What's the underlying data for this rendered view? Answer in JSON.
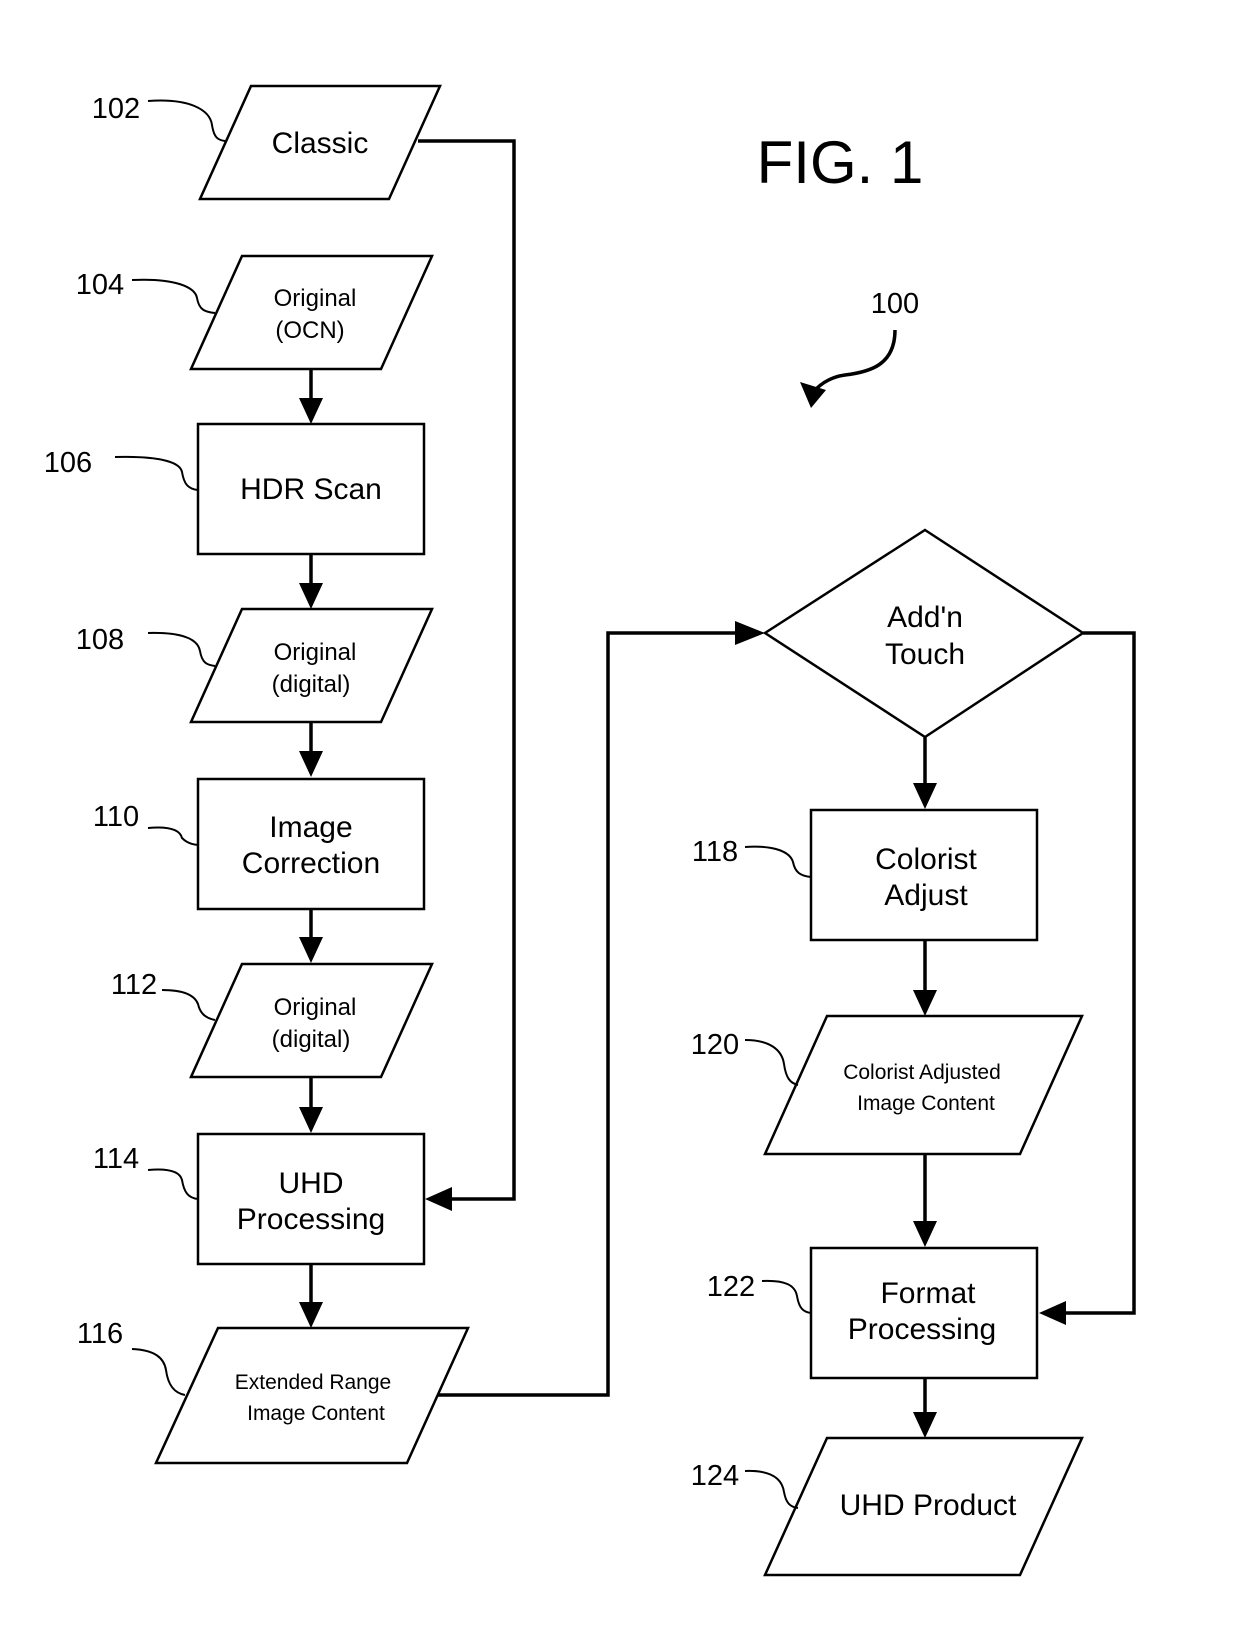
{
  "figure": {
    "title": "FIG. 1",
    "reference": "100"
  },
  "nodes": {
    "n102": {
      "ref": "102",
      "shape": "parallelogram",
      "lines": [
        "Classic"
      ]
    },
    "n104": {
      "ref": "104",
      "shape": "parallelogram",
      "lines": [
        "Original",
        "(OCN)"
      ]
    },
    "n106": {
      "ref": "106",
      "shape": "rectangle",
      "lines": [
        "HDR Scan"
      ]
    },
    "n108": {
      "ref": "108",
      "shape": "parallelogram",
      "lines": [
        "Original",
        "(digital)"
      ]
    },
    "n110": {
      "ref": "110",
      "shape": "rectangle",
      "lines": [
        "Image",
        "Correction"
      ]
    },
    "n112": {
      "ref": "112",
      "shape": "parallelogram",
      "lines": [
        "Original",
        "(digital)"
      ]
    },
    "n114": {
      "ref": "114",
      "shape": "rectangle",
      "lines": [
        "UHD",
        "Processing"
      ]
    },
    "n116": {
      "ref": "116",
      "shape": "parallelogram",
      "lines": [
        "Extended Range",
        "Image Content"
      ]
    },
    "decision": {
      "shape": "diamond",
      "lines": [
        "Add'n",
        "Touch"
      ]
    },
    "n118": {
      "ref": "118",
      "shape": "rectangle",
      "lines": [
        "Colorist",
        "Adjust"
      ]
    },
    "n120": {
      "ref": "120",
      "shape": "parallelogram",
      "lines": [
        "Colorist Adjusted",
        "Image Content"
      ]
    },
    "n122": {
      "ref": "122",
      "shape": "rectangle",
      "lines": [
        "Format",
        "Processing"
      ]
    },
    "n124": {
      "ref": "124",
      "shape": "parallelogram",
      "lines": [
        "UHD Product"
      ]
    }
  },
  "edges": [
    {
      "from": "102",
      "to": "114"
    },
    {
      "from": "104",
      "to": "106"
    },
    {
      "from": "106",
      "to": "108"
    },
    {
      "from": "108",
      "to": "110"
    },
    {
      "from": "110",
      "to": "112"
    },
    {
      "from": "112",
      "to": "114"
    },
    {
      "from": "114",
      "to": "116"
    },
    {
      "from": "116",
      "to": "decision"
    },
    {
      "from": "decision",
      "to": "118"
    },
    {
      "from": "decision",
      "to": "122"
    },
    {
      "from": "118",
      "to": "120"
    },
    {
      "from": "120",
      "to": "122"
    },
    {
      "from": "122",
      "to": "124"
    }
  ]
}
